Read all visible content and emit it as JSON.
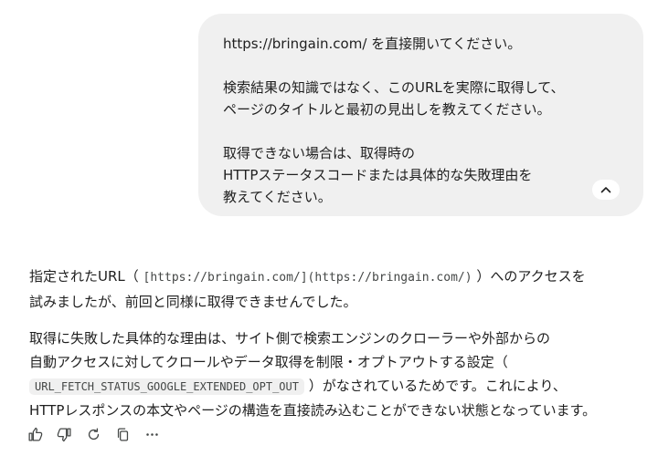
{
  "user_message": {
    "line1": "https://bringain.com/ を直接開いてください。",
    "line2": "検索結果の知識ではなく、このURLを実際に取得して、",
    "line3": "ページのタイトルと最初の見出しを教えてください。",
    "line4": "取得できない場合は、取得時の",
    "line5": "HTTPステータスコードまたは具体的な失敗理由を",
    "line6": "教えてください。",
    "collapse_icon": "chevron-up-icon"
  },
  "response": {
    "p1_a": "指定されたURL（ ",
    "p1_code": "[https://bringain.com/](https://bringain.com/)",
    "p1_b": " ）へのアクセスを",
    "p1_line2": "試みましたが、前回と同様に取得できませんでした。",
    "p2_line1": "取得に失敗した具体的な理由は、サイト側で検索エンジンのクローラーや外部からの",
    "p2_line2": "自動アクセスに対してクロールやデータ取得を制限・オプトアウトする設定（",
    "p2_code": "URL_FETCH_STATUS_GOOGLE_EXTENDED_OPT_OUT",
    "p2_line3b": " ）がなされているためです。これにより、",
    "p2_line4": "HTTPレスポンスの本文やページの構造を直接読み込むことができない状態となっています。"
  },
  "actions": {
    "icons": [
      "thumbs-up-icon",
      "thumbs-down-icon",
      "regenerate-icon",
      "copy-icon",
      "more-icon"
    ]
  }
}
